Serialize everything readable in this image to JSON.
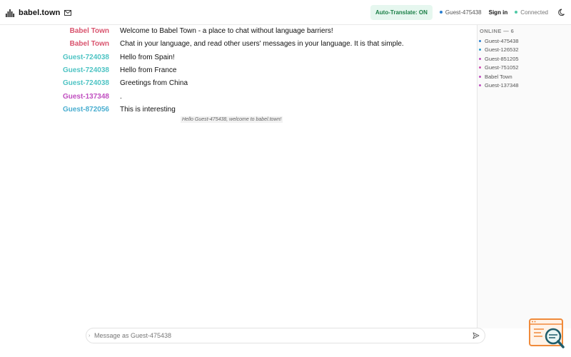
{
  "header": {
    "brand_name": "babel.town",
    "auto_translate": "Auto-Translate: ON",
    "current_user": "Guest-475438",
    "sign_in": "Sign in",
    "status": "Connected"
  },
  "messages": [
    {
      "author": "Babel Town",
      "text": "Welcome to Babel Town - a place to chat without language barriers!",
      "color": "#d9546e"
    },
    {
      "author": "Babel Town",
      "text": "Chat in your language, and read other users' messages in your language. It is that simple.",
      "color": "#d9546e"
    },
    {
      "author": "Guest-724038",
      "text": "Hello from Spain!",
      "color": "#4fc4c4"
    },
    {
      "author": "Guest-724038",
      "text": "Hello from France",
      "color": "#4fc4c4"
    },
    {
      "author": "Guest-724038",
      "text": "Greetings from China",
      "color": "#4fc4c4"
    },
    {
      "author": "Guest-137348",
      "text": ".",
      "color": "#c04fc0"
    },
    {
      "author": "Guest-872056",
      "text": "This is interesting",
      "color": "#4aaed0"
    }
  ],
  "system_message": "Hello Guest-475438, welcome to babel.town!",
  "online": {
    "title": "ONLINE — 6",
    "users": [
      {
        "name": "Guest-475438",
        "color": "#2a7fd0"
      },
      {
        "name": "Guest-126532",
        "color": "#2a9bd0"
      },
      {
        "name": "Guest-851205",
        "color": "#c04fc0"
      },
      {
        "name": "Guest-751052",
        "color": "#d04fb0"
      },
      {
        "name": "Babel Town",
        "color": "#c04fc0"
      },
      {
        "name": "Guest-137348",
        "color": "#c04fc0"
      }
    ]
  },
  "composer": {
    "placeholder": "Message as Guest-475438"
  },
  "colors": {
    "accent_green": "#1a7f46",
    "connected_dot": "#4fc9a6",
    "me_dot": "#2a7fd0"
  }
}
